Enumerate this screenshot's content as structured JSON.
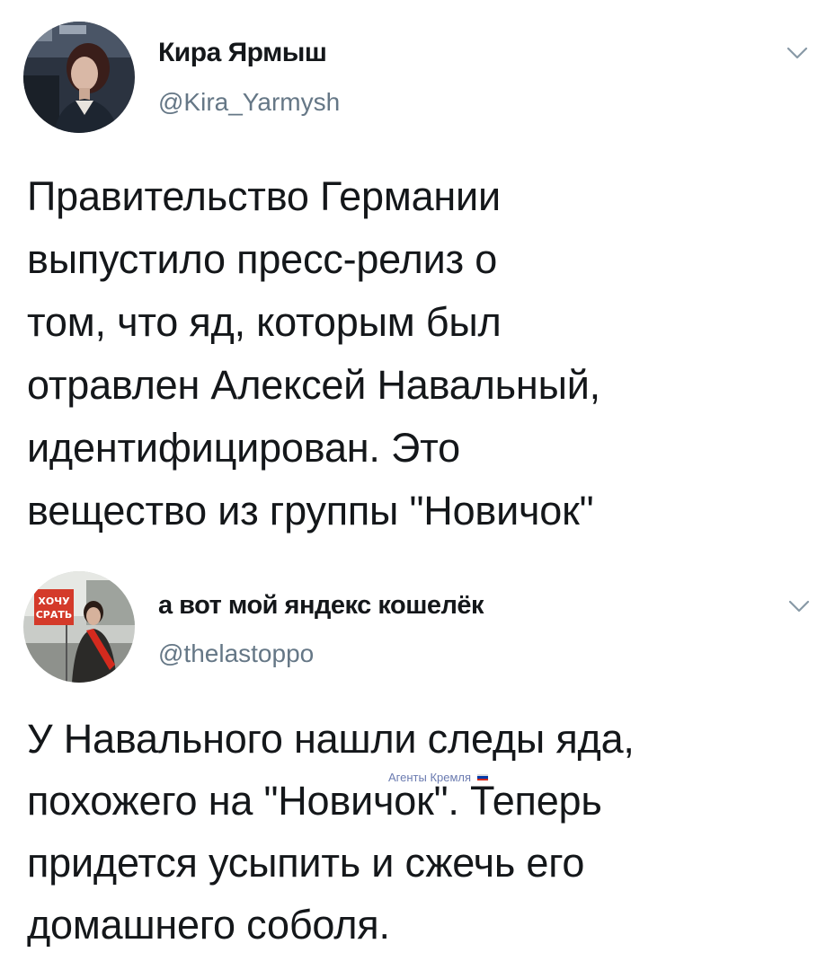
{
  "tweets": [
    {
      "display_name": "Кира Ярмыш",
      "handle": "@Kira_Yarmysh",
      "text": "Правительство Германии\nвыпустило пресс-релиз о\nтом, что яд, которым был\nотравлен Алексей Навальный,\nидентифицирован. Это\nвещество из группы \"Новичок\"",
      "menu_icon": "chevron-down-icon"
    },
    {
      "display_name": "а вот мой яндекс кошелёк",
      "handle": "@thelastoppo",
      "text": "У Навального нашли следы яда,\nпохожего на \"Новичок\". Теперь\nпридется усыпить и сжечь его\nдомашнего соболя.",
      "menu_icon": "chevron-down-icon",
      "avatar_sign_text": "ХОЧУ СРАТЬ"
    }
  ],
  "watermark": {
    "text": "Агенты Кремля",
    "flag_colors": [
      "#ffffff",
      "#0039a6",
      "#d52b1e"
    ]
  },
  "colors": {
    "text_primary": "#14171a",
    "text_secondary": "#657786",
    "chevron": "#8899a6"
  }
}
